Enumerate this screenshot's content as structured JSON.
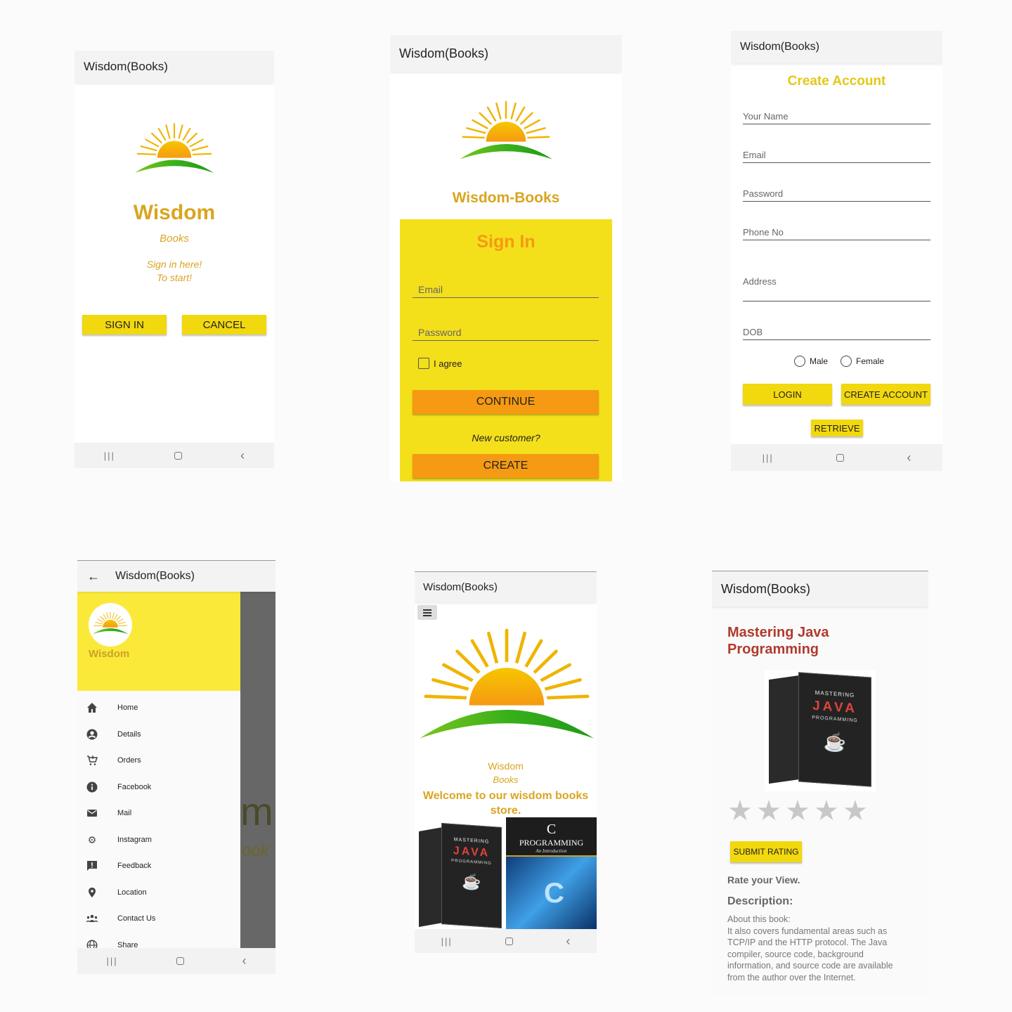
{
  "app_title": "Wisdom(Books)",
  "screen1": {
    "brand_title": "Wisdom",
    "brand_subtitle": "Books",
    "prompt_line1": "Sign in here!",
    "prompt_line2": "To start!",
    "signin_label": "SIGN IN",
    "cancel_label": "CANCEL"
  },
  "screen2": {
    "brand_title": "Wisdom-Books",
    "panel_title": "Sign In",
    "email_placeholder": "Email",
    "password_placeholder": "Password",
    "agree_label": "I agree",
    "continue_label": "CONTINUE",
    "new_customer_text": "New customer?",
    "create_label": "CREATE"
  },
  "screen3": {
    "title": "Create Account",
    "fields": [
      "Your Name",
      "Email",
      "Password",
      "Phone No",
      "Address",
      "DOB"
    ],
    "gender_options": [
      "Male",
      "Female"
    ],
    "login_label": "LOGIN",
    "create_account_label": "CREATE ACCOUNT",
    "retrieve_label": "RETRIEVE"
  },
  "screen4": {
    "header_name": "Wisdom",
    "menu_items": [
      {
        "label": "Home",
        "icon": "home-icon"
      },
      {
        "label": "Details",
        "icon": "account-icon"
      },
      {
        "label": "Orders",
        "icon": "cart-icon"
      },
      {
        "label": "Facebook",
        "icon": "info-icon"
      },
      {
        "label": "Mail",
        "icon": "mail-icon"
      },
      {
        "label": "Instagram",
        "icon": "gear-icon"
      },
      {
        "label": "Feedback",
        "icon": "feedback-icon"
      },
      {
        "label": "Location",
        "icon": "location-icon"
      },
      {
        "label": "Contact Us",
        "icon": "people-icon"
      },
      {
        "label": "Share",
        "icon": "globe-icon"
      }
    ],
    "behind_text_1": "m",
    "behind_text_2": "ook"
  },
  "screen5": {
    "brand_title": "Wisdom",
    "brand_subtitle": "Books",
    "welcome_text": "Welcome to our wisdom books store.",
    "book1_title": "JAVA",
    "book1_sub": "MASTERING",
    "book1_tag": "PROGRAMMING",
    "book2_title": "C",
    "book2_sub": "PROGRAMMING",
    "book2_tag": "An Introduction"
  },
  "screen6": {
    "book_title": "Mastering Java Programming",
    "rating": 0,
    "max_rating": 5,
    "submit_label": "SUBMIT RATING",
    "rate_text": "Rate your View.",
    "description_heading": "Description:",
    "description_text": "About this book:\nIt also covers fundamental areas such as TCP/IP and the HTTP protocol. The Java compiler, source code, background information, and source code are available from the author over the Internet.",
    "book_cover_title": "JAVA",
    "book_cover_sub": "MASTERING",
    "book_cover_tag": "PROGRAMMING"
  },
  "colors": {
    "brand_gold": "#d9a520",
    "yellow": "#f2d80e",
    "orange": "#f59a12",
    "panel_yellow": "#f4df1b",
    "drawer_yellow": "#fbe93a",
    "title_red": "#b03a2e"
  }
}
